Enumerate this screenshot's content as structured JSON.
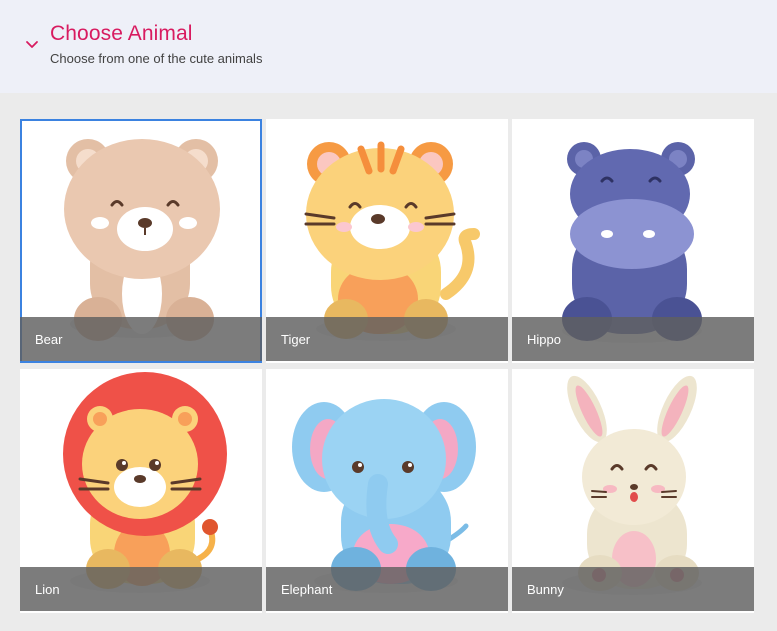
{
  "header": {
    "title": "Choose Animal",
    "subtitle": "Choose from one of the cute animals"
  },
  "colors": {
    "accent": "#d81b60",
    "selection": "#3b82e0",
    "caption_bg": "#5f5f5f"
  },
  "animals": [
    {
      "label": "Bear",
      "selected": true
    },
    {
      "label": "Tiger",
      "selected": false
    },
    {
      "label": "Hippo",
      "selected": false
    },
    {
      "label": "Lion",
      "selected": false
    },
    {
      "label": "Elephant",
      "selected": false
    },
    {
      "label": "Bunny",
      "selected": false
    }
  ]
}
